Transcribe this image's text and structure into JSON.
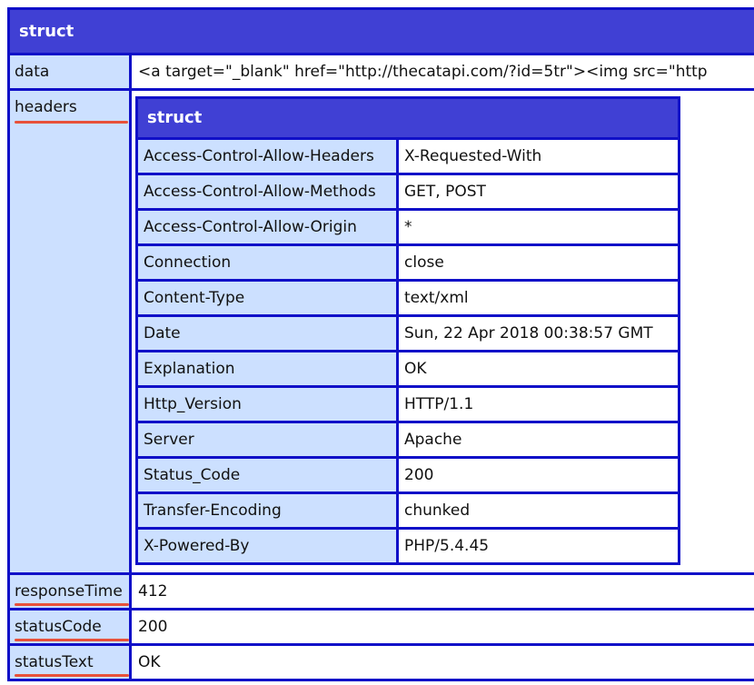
{
  "outer": {
    "title": "struct",
    "data_key": "data",
    "data_value": "<a target=\"_blank\" href=\"http://thecatapi.com/?id=5tr\"><img src=\"http",
    "headers_key": "headers",
    "response_time_key": "responseTime",
    "response_time_value": "412",
    "status_code_key": "statusCode",
    "status_code_value": "200",
    "status_text_key": "statusText",
    "status_text_value": "OK"
  },
  "headers": {
    "title": "struct",
    "rows": [
      {
        "key": "Access-Control-Allow-Headers",
        "value": "X-Requested-With"
      },
      {
        "key": "Access-Control-Allow-Methods",
        "value": "GET, POST"
      },
      {
        "key": "Access-Control-Allow-Origin",
        "value": "*"
      },
      {
        "key": "Connection",
        "value": "close"
      },
      {
        "key": "Content-Type",
        "value": "text/xml"
      },
      {
        "key": "Date",
        "value": "Sun, 22 Apr 2018 00:38:57 GMT"
      },
      {
        "key": "Explanation",
        "value": "OK"
      },
      {
        "key": "Http_Version",
        "value": "HTTP/1.1"
      },
      {
        "key": "Server",
        "value": "Apache"
      },
      {
        "key": "Status_Code",
        "value": "200"
      },
      {
        "key": "Transfer-Encoding",
        "value": "chunked"
      },
      {
        "key": "X-Powered-By",
        "value": "PHP/5.4.45"
      }
    ]
  },
  "colors": {
    "header_bg": "#4040d4",
    "border": "#1010c8",
    "key_bg": "#cce0ff",
    "underline": "#e8513a"
  }
}
